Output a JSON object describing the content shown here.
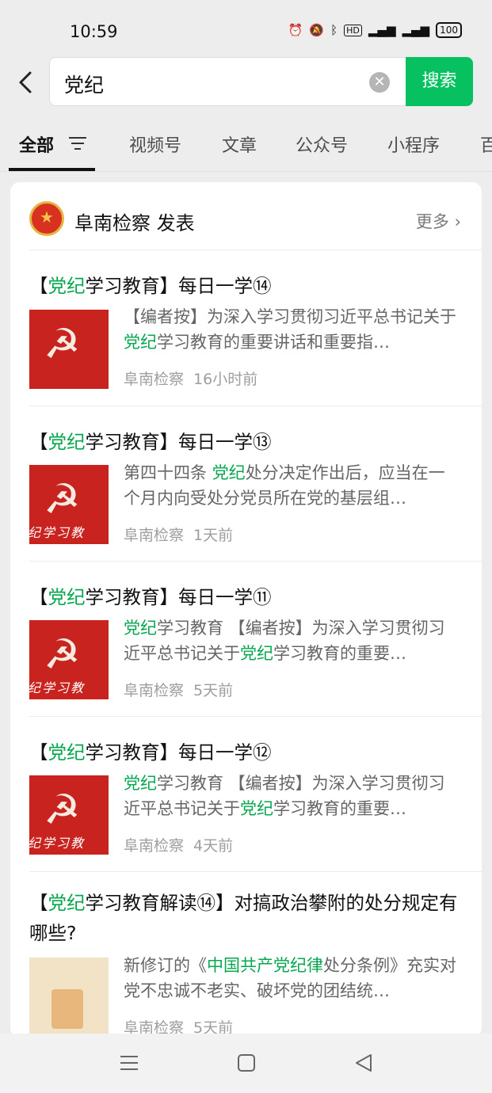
{
  "status_bar": {
    "time": "10:59",
    "battery": "100"
  },
  "search": {
    "query": "党纪",
    "clear_icon": "clear-icon",
    "button_label": "搜索"
  },
  "tabs": [
    {
      "label": "全部",
      "active": true
    },
    {
      "label": "视频号"
    },
    {
      "label": "文章"
    },
    {
      "label": "公众号"
    },
    {
      "label": "小程序"
    },
    {
      "label": "百"
    }
  ],
  "account": {
    "name": "阜南检察 发表",
    "more": "更多"
  },
  "articles": [
    {
      "title_pre": "【",
      "title_hl": "党纪",
      "title_post": "学习教育】每日一学⑭",
      "snippet_parts": [
        "【编者按】为深入学习贯彻习近平总书记关于",
        "党纪",
        "学习教育的重要讲话和重要指…"
      ],
      "source": "阜南检察",
      "time": "16小时前"
    },
    {
      "title_pre": "【",
      "title_hl": "党纪",
      "title_post": "学习教育】每日一学⑬",
      "snippet_parts": [
        "第四十四条 ",
        "党纪",
        "处分决定作出后，应当在一个月内向受处分党员所在党的基层组…"
      ],
      "source": "阜南检察",
      "time": "1天前",
      "thumb_text": "纪学习教"
    },
    {
      "title_pre": "【",
      "title_hl": "党纪",
      "title_post": "学习教育】每日一学⑪",
      "snippet_parts": [
        "",
        "党纪",
        "学习教育 【编者按】为深入学习贯彻习近平总书记关于",
        "党纪",
        "学习教育的重要…"
      ],
      "source": "阜南检察",
      "time": "5天前",
      "thumb_text": "纪学习教"
    },
    {
      "title_pre": "【",
      "title_hl": "党纪",
      "title_post": "学习教育】每日一学⑫",
      "snippet_parts": [
        "",
        "党纪",
        "学习教育 【编者按】为深入学习贯彻习近平总书记关于",
        "党纪",
        "学习教育的重要…"
      ],
      "source": "阜南检察",
      "time": "4天前",
      "thumb_text": "纪学习教"
    },
    {
      "title_pre": "【",
      "title_hl": "党纪",
      "title_post": "学习教育解读⑭】对搞政治攀附的处分规定有哪些?",
      "snippet_parts": [
        "新修订的《",
        "中国共产党纪律",
        "处分条例》充实对党不忠诚不老实、破坏党的团结统…"
      ],
      "source": "阜南检察",
      "time": "5天前"
    }
  ]
}
